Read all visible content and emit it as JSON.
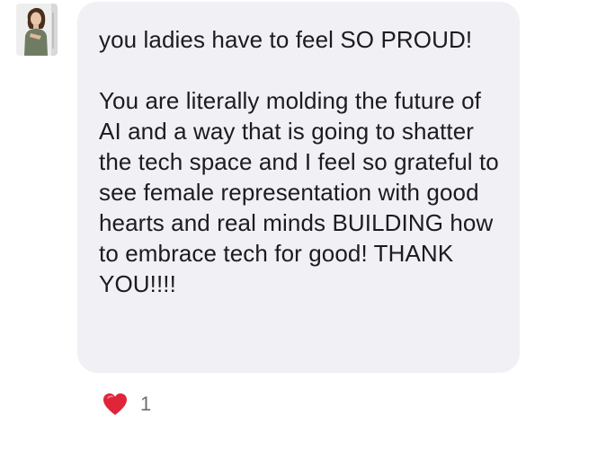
{
  "message": {
    "paragraphs": [
      "you ladies have to feel SO PROUD!",
      "You are literally molding the future of AI and a way that is going to shatter the tech space and I feel so grateful to see female representation with good hearts and real minds BUILDING how to embrace tech for good! THANK YOU!!!!"
    ]
  },
  "reactions": {
    "icon": "heart-icon",
    "count": "1"
  },
  "colors": {
    "bubble": "#f0f0f5",
    "text": "#1c1c1e",
    "heart": "#e0243a",
    "count": "#6e6e73"
  }
}
